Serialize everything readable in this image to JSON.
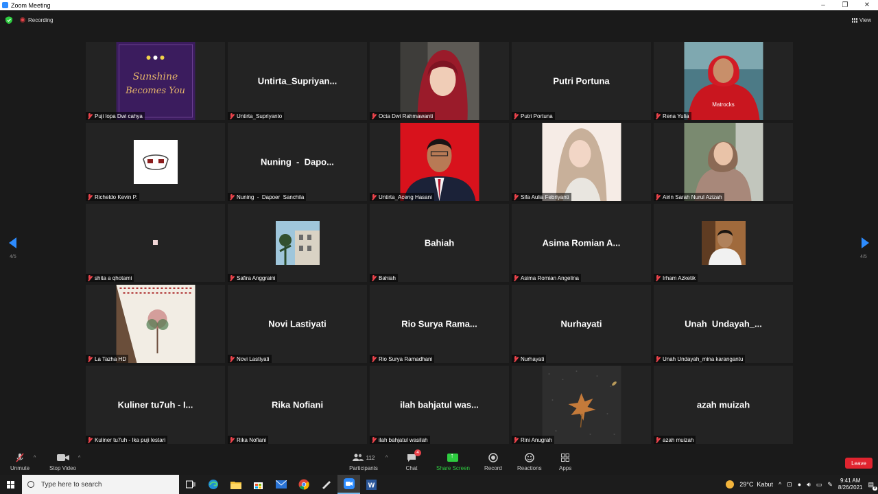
{
  "window": {
    "title": "Zoom Meeting"
  },
  "topbar": {
    "recording_label": "Recording",
    "view_label": "View"
  },
  "gallery": {
    "page_indicator": "4/5",
    "tiles": [
      {
        "name": "Puji lopa Dwi cahya",
        "display": "",
        "media": "photo-sunshine",
        "photo_text": "Sunshine Becomes You"
      },
      {
        "name": "Untirta_Supriyanto",
        "display": "Untirta_Supriyan...",
        "media": "none"
      },
      {
        "name": "Octa Dwi Rahmawanti",
        "display": "",
        "media": "photo-hijab-red"
      },
      {
        "name": "Putri Portuna",
        "display": "Putri Portuna",
        "media": "none"
      },
      {
        "name": "Rena Yulia",
        "display": "",
        "media": "photo-red-hoodie"
      },
      {
        "name": "Richeldo Kevin P.",
        "display": "",
        "media": "small-drawing"
      },
      {
        "name": "Nuning  -  Dapoer  Sanchila",
        "display": "Nuning  -  Dapo...",
        "media": "none"
      },
      {
        "name": "Untirta_Aceng Hasani",
        "display": "",
        "media": "photo-suit-red"
      },
      {
        "name": "Sifa Aulia Febriyanti",
        "display": "",
        "media": "photo-hijab-light"
      },
      {
        "name": "Airin Sarah Nurul Azizah",
        "display": "",
        "media": "photo-hijab-brown"
      },
      {
        "name": "shita a qhotami",
        "display": "",
        "media": "tiny-square"
      },
      {
        "name": "Safira Anggraini",
        "display": "",
        "media": "small-building"
      },
      {
        "name": "Bahiah",
        "display": "Bahiah",
        "media": "none"
      },
      {
        "name": "Asima Romian Angelina",
        "display": "Asima Romian A...",
        "media": "none"
      },
      {
        "name": "Irham Azketik",
        "display": "",
        "media": "small-man"
      },
      {
        "name": "La Tazha HD",
        "display": "",
        "media": "photo-batik"
      },
      {
        "name": "Novi Lastiyati",
        "display": "Novi Lastiyati",
        "media": "none"
      },
      {
        "name": "Rio Surya Ramadhani",
        "display": "Rio Surya Rama...",
        "media": "none"
      },
      {
        "name": "Nurhayati",
        "display": "Nurhayati",
        "media": "none"
      },
      {
        "name": "Unah Undayah_mina karangantu",
        "display": "Unah  Undayah_...",
        "media": "none"
      },
      {
        "name": "Kuliner tu7uh - Ika puji lestari",
        "display": "Kuliner tu7uh - I...",
        "media": "none"
      },
      {
        "name": "Rika Nofiani",
        "display": "Rika Nofiani",
        "media": "none"
      },
      {
        "name": "ilah bahjatul wasilah",
        "display": "ilah bahjatul was...",
        "media": "none"
      },
      {
        "name": "Rini Anugrah",
        "display": "",
        "media": "photo-leaf"
      },
      {
        "name": "azah muizah",
        "display": "azah muizah",
        "media": "none"
      }
    ]
  },
  "toolbar": {
    "unmute": "Unmute",
    "stop_video": "Stop Video",
    "participants": "Participants",
    "participants_count": "112",
    "chat": "Chat",
    "chat_badge": "4",
    "share_screen": "Share Screen",
    "record": "Record",
    "reactions": "Reactions",
    "apps": "Apps",
    "leave": "Leave"
  },
  "taskbar": {
    "search_placeholder": "Type here to search",
    "weather": "29°C  Kabut",
    "time": "9:41 AM",
    "date": "8/26/2021",
    "notification_count": "9"
  },
  "colors": {
    "accent": "#2d8cff",
    "leave": "#e0242f",
    "share": "#2ecc40",
    "muted": "#e8424a"
  }
}
